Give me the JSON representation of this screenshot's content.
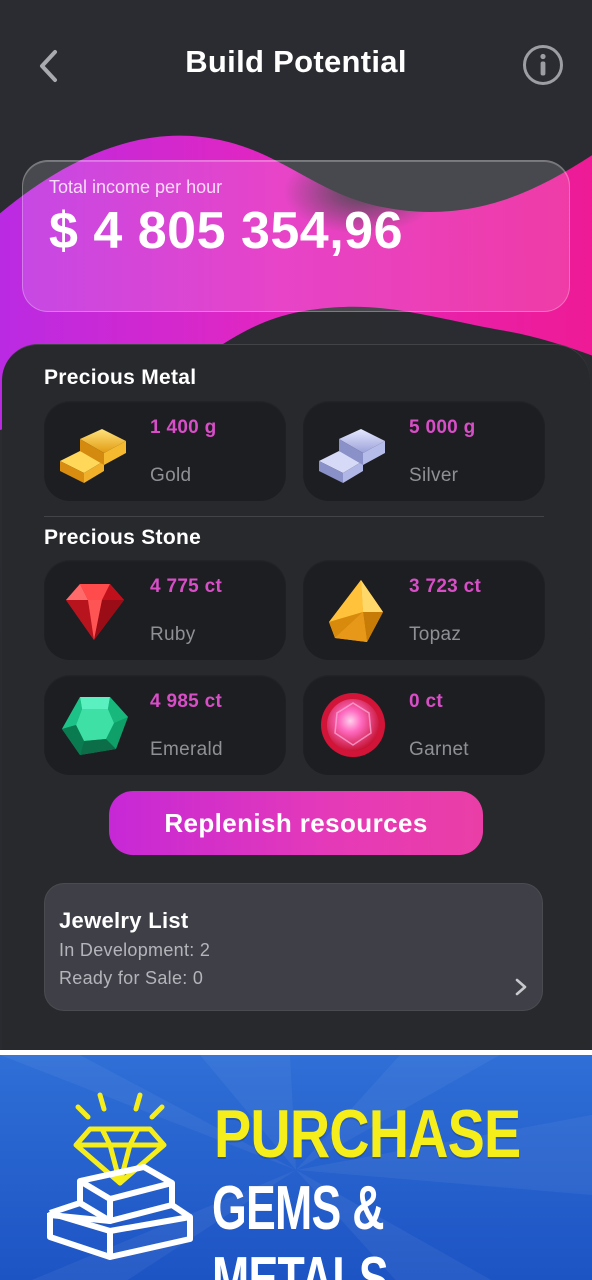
{
  "header": {
    "title": "Build Potential"
  },
  "income": {
    "label": "Total income per hour",
    "value": "$ 4 805 354,96"
  },
  "sections": {
    "metal_title": "Precious Metal",
    "stone_title": "Precious Stone"
  },
  "metals": [
    {
      "amount": "1 400 g",
      "name": "Gold",
      "icon": "gold-bars-icon"
    },
    {
      "amount": "5 000 g",
      "name": "Silver",
      "icon": "silver-bars-icon"
    }
  ],
  "stones": [
    {
      "amount": "4 775 ct",
      "name": "Ruby",
      "icon": "ruby-gem-icon"
    },
    {
      "amount": "3 723 ct",
      "name": "Topaz",
      "icon": "topaz-gem-icon"
    },
    {
      "amount": "4 985 ct",
      "name": "Emerald",
      "icon": "emerald-gem-icon"
    },
    {
      "amount": "0 ct",
      "name": "Garnet",
      "icon": "garnet-gem-icon"
    }
  ],
  "actions": {
    "replenish_label": "Replenish resources"
  },
  "jewelry": {
    "title": "Jewelry List",
    "in_development": "In Development: 2",
    "ready_for_sale": "Ready for Sale: 0"
  },
  "banner": {
    "line1": "PURCHASE",
    "line2": "GEMS & METALS"
  },
  "colors": {
    "accent": "#d84ec7",
    "background": "#2b2c31",
    "tile": "#1d1e22",
    "banner_blue": "#2760cc",
    "banner_yellow": "#f6ee1a"
  }
}
